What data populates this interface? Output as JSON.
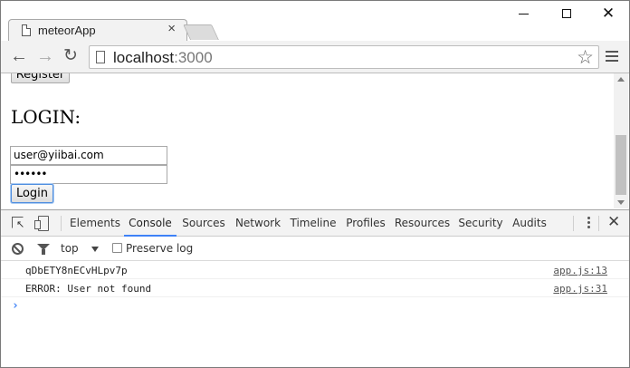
{
  "browser": {
    "tab": {
      "title": "meteorApp",
      "close_glyph": "×"
    },
    "window_controls": {
      "close_glyph": "✕"
    },
    "toolbar": {
      "back_glyph": "←",
      "forward_glyph": "→",
      "reload_glyph": "↻",
      "url_host": "localhost",
      "url_port": ":3000",
      "star_glyph": "☆"
    }
  },
  "page": {
    "register_button": "Register",
    "login_heading": "LOGIN:",
    "email_value": "user@yiibai.com",
    "password_value": "••••••",
    "login_button": "Login"
  },
  "devtools": {
    "tabs": [
      {
        "label": "Elements",
        "active": false
      },
      {
        "label": "Console",
        "active": true
      },
      {
        "label": "Sources",
        "active": false
      },
      {
        "label": "Network",
        "active": false
      },
      {
        "label": "Timeline",
        "active": false
      },
      {
        "label": "Profiles",
        "active": false
      },
      {
        "label": "Resources",
        "active": false
      },
      {
        "label": "Security",
        "active": false
      },
      {
        "label": "Audits",
        "active": false
      }
    ],
    "close_glyph": "✕",
    "filter_bar": {
      "context": "top",
      "preserve_log_label": "Preserve log",
      "preserve_log_checked": false
    },
    "console": {
      "messages": [
        {
          "text": "qDbETY8nECvHLpv7p",
          "source": "app.js:13"
        },
        {
          "text": "ERROR: User not found",
          "source": "app.js:31"
        }
      ],
      "prompt_glyph": "›"
    },
    "accent_color": "#3e82f7"
  }
}
